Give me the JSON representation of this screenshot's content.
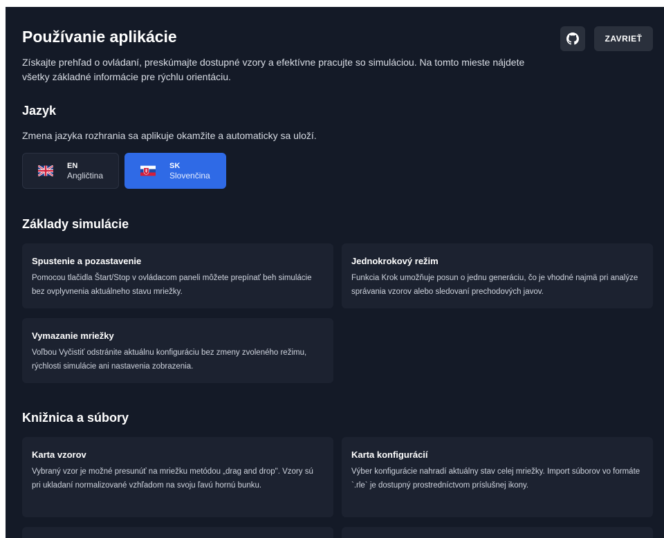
{
  "header": {
    "title": "Používanie aplikácie",
    "description": "Získajte prehľad o ovládaní, preskúmajte dostupné vzory a efektívne pracujte so simuláciou. Na tomto mieste nájdete všetky základné informácie pre rýchlu orientáciu.",
    "close_label": "ZAVRIEŤ",
    "github_icon": "github-icon"
  },
  "language": {
    "title": "Jazyk",
    "description": "Zmena jazyka rozhrania sa aplikuje okamžite a automaticky sa uloží.",
    "options": [
      {
        "code": "EN",
        "name": "Angličtina",
        "flag": "uk-flag-icon",
        "selected": false
      },
      {
        "code": "SK",
        "name": "Slovenčina",
        "flag": "sk-flag-icon",
        "selected": true
      }
    ]
  },
  "basics": {
    "title": "Základy simulácie",
    "cards": [
      {
        "title": "Spustenie a pozastavenie",
        "body": "Pomocou tlačidla Štart/Stop v ovládacom paneli môžete prepínať beh simulácie bez ovplyvnenia aktuálneho stavu mriežky."
      },
      {
        "title": "Jednokrokový režim",
        "body": "Funkcia Krok umožňuje posun o jednu generáciu, čo je vhodné najmä pri analýze správania vzorov alebo sledovaní prechodových javov."
      },
      {
        "title": "Vymazanie mriežky",
        "body": "Voľbou Vyčistiť odstránite aktuálnu konfiguráciu bez zmeny zvoleného režimu, rýchlosti simulácie ani nastavenia zobrazenia."
      }
    ]
  },
  "library": {
    "title": "Knižnica a súbory",
    "cards": [
      {
        "title": "Karta vzorov",
        "body": "Vybraný vzor je možné presunúť na mriežku metódou „drag and drop\". Vzory sú pri ukladaní normalizované vzhľadom na svoju ľavú hornú bunku."
      },
      {
        "title": "Karta konfigurácií",
        "body": "Výber konfigurácie nahradí aktuálny stav celej mriežky. Import súborov vo formáte `.rle` je dostupný prostredníctvom príslušnej ikony."
      }
    ]
  },
  "colors": {
    "background": "#141a27",
    "card": "#1c2230",
    "accent": "#2f6ae6"
  }
}
